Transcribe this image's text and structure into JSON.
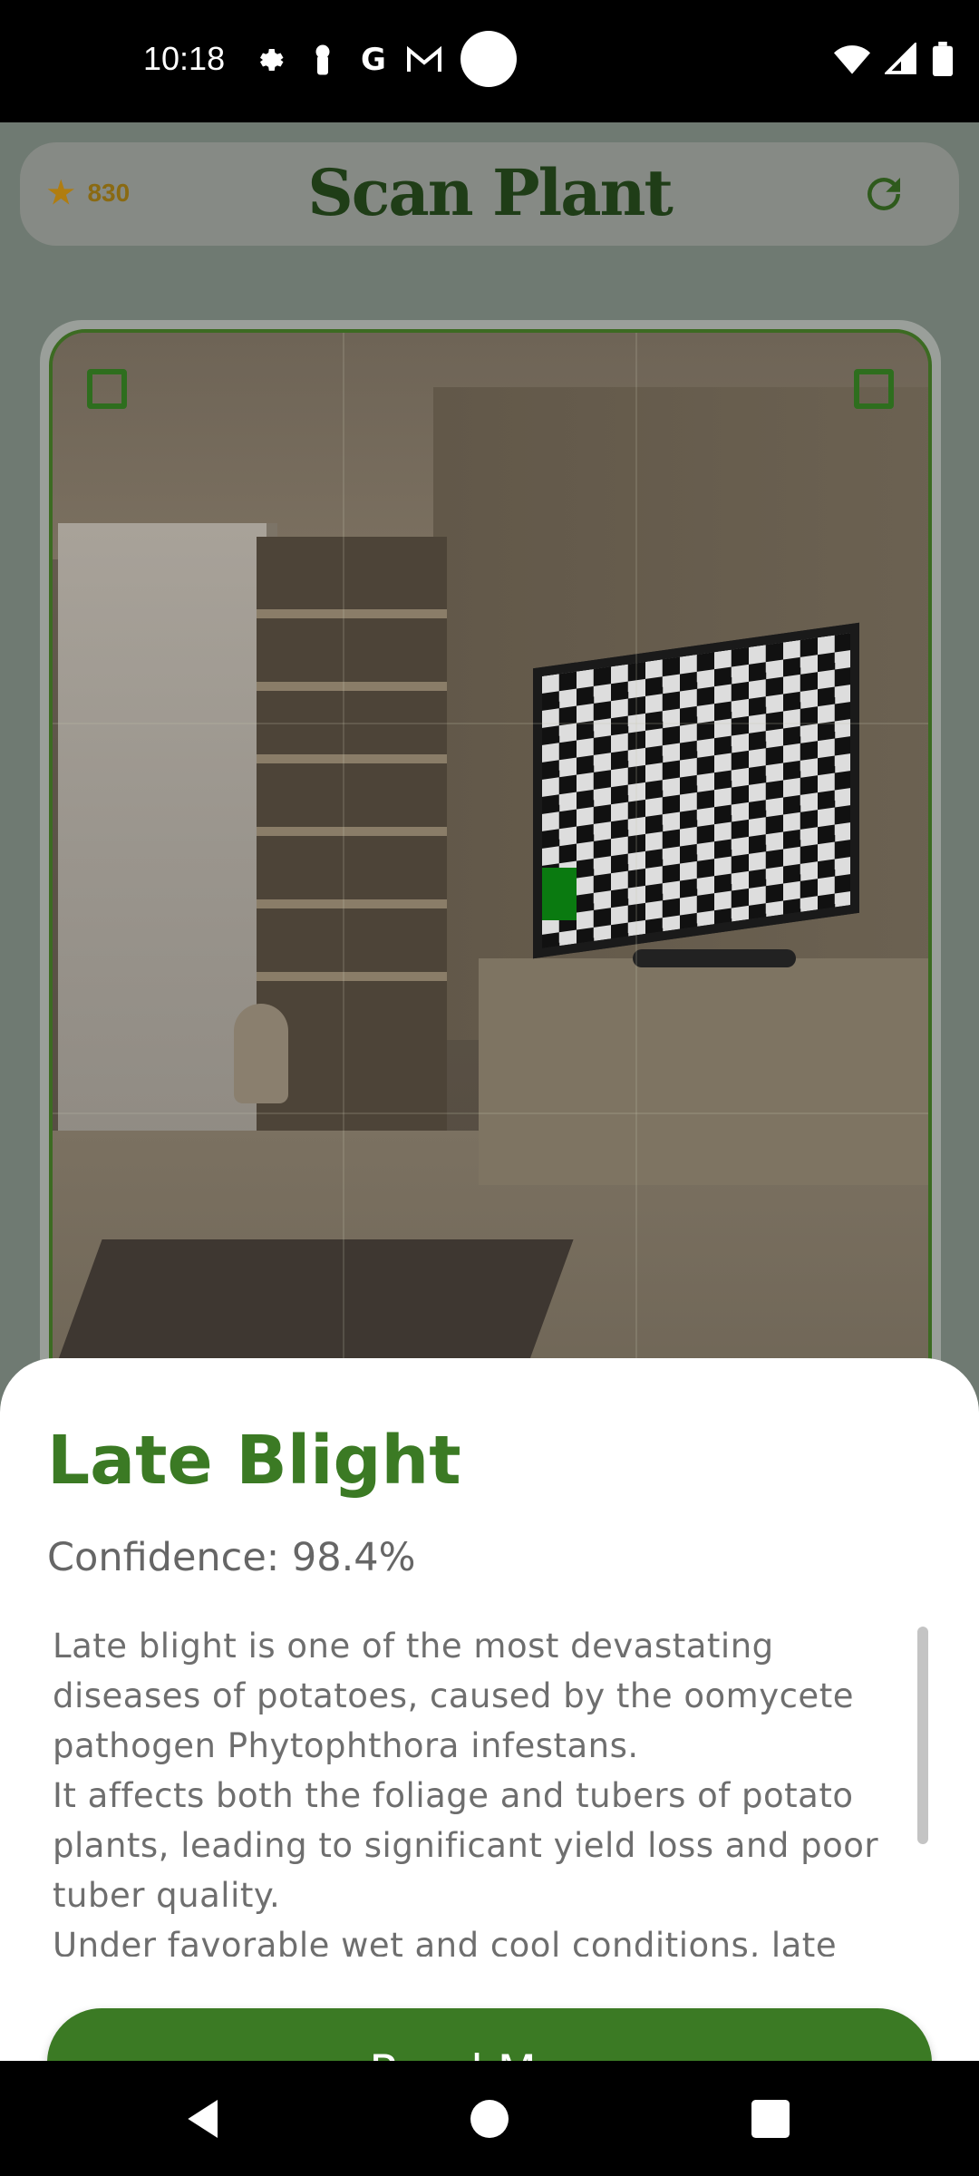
{
  "status_bar": {
    "time": "10:18",
    "icons": [
      "gear-icon",
      "key-icon",
      "google-g-icon",
      "gmail-icon",
      "circle-icon",
      "wifi-icon",
      "signal-icon",
      "battery-icon"
    ]
  },
  "header": {
    "points": "830",
    "title": "Scan Plant",
    "refresh_icon": "refresh-icon"
  },
  "result": {
    "title": "Late Blight",
    "confidence": "Confidence: 98.4%",
    "description": "Late blight is one of the most devastating diseases of potatoes, caused by the oomycete pathogen Phytophthora infestans.\nIt affects both the foliage and tubers of potato plants, leading to significant yield loss and poor tuber quality.\nUnder favorable wet and cool conditions, late",
    "button_label": "Read More"
  },
  "colors": {
    "accent": "#3b7a24",
    "title_dark_green": "#1f3d17",
    "points_gold": "#b07d10"
  },
  "nav": {
    "icons": [
      "back-icon",
      "home-icon",
      "recents-icon"
    ]
  }
}
